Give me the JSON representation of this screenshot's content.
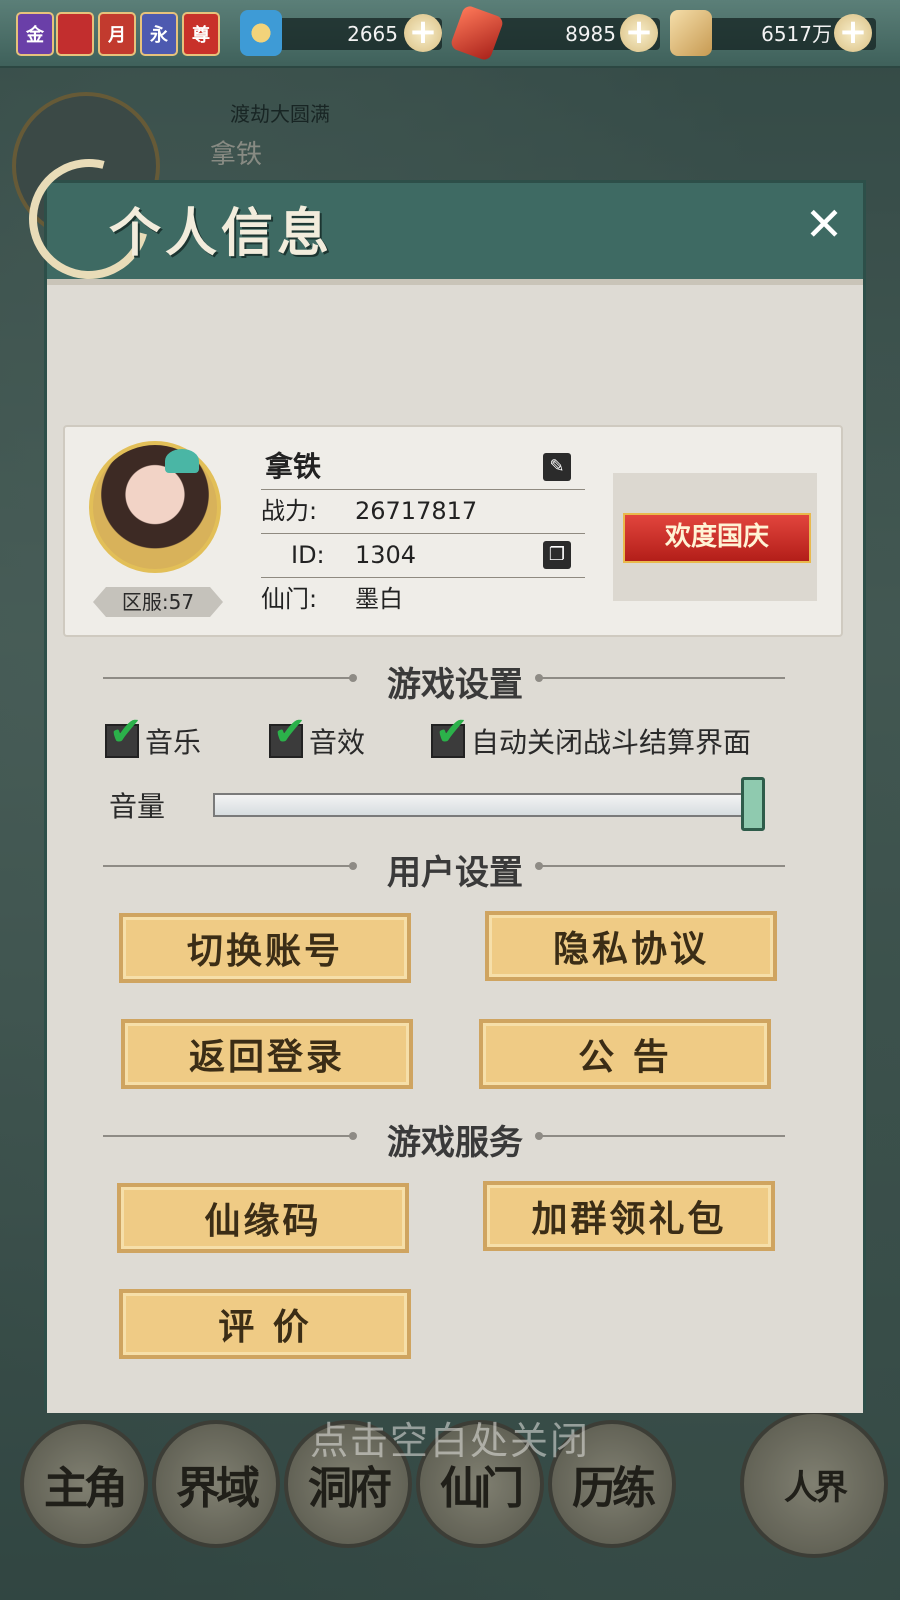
{
  "topbar": {
    "badges": [
      {
        "label": "金",
        "color": "#6a3fa8"
      },
      {
        "label": "",
        "color": "#c22e2e"
      },
      {
        "label": "月",
        "color": "#c23a2e"
      },
      {
        "label": "永",
        "color": "#4d5ab0"
      },
      {
        "label": "尊",
        "color": "#c8312a"
      }
    ],
    "resources": [
      {
        "icon": "jade-swirl-icon",
        "value": "2665",
        "color": "#3e9bd6"
      },
      {
        "icon": "red-crystal-icon",
        "value": "8985",
        "color": "#d4402f"
      },
      {
        "icon": "gold-scroll-icon",
        "value": "6517万",
        "color": "#e6c07a"
      }
    ]
  },
  "background": {
    "realm_title": "渡劫大圆满",
    "player_name": "拿铁",
    "close_hint": "点击空白处关闭",
    "nav": [
      "主角",
      "界域",
      "洞府",
      "仙门",
      "历练",
      "人界"
    ]
  },
  "dialog": {
    "title": "个人信息",
    "profile": {
      "name": "拿铁",
      "power_label": "战力:",
      "power_value": "26717817",
      "id_label": "ID:",
      "id_value": "1304",
      "sect_label": "仙门:",
      "sect_value": "墨白",
      "server": "区服:57",
      "banner": "欢度国庆"
    },
    "game_settings": {
      "title": "游戏设置",
      "music": "音乐",
      "sfx": "音效",
      "auto_close": "自动关闭战斗结算界面",
      "volume_label": "音量",
      "volume_level": 1.0
    },
    "user_settings": {
      "title": "用户设置",
      "switch_account": "切换账号",
      "privacy": "隐私协议",
      "back_login": "返回登录",
      "notice": "公 告"
    },
    "game_services": {
      "title": "游戏服务",
      "fairy_code": "仙缘码",
      "join_group": "加群领礼包",
      "rate": "评 价"
    }
  }
}
